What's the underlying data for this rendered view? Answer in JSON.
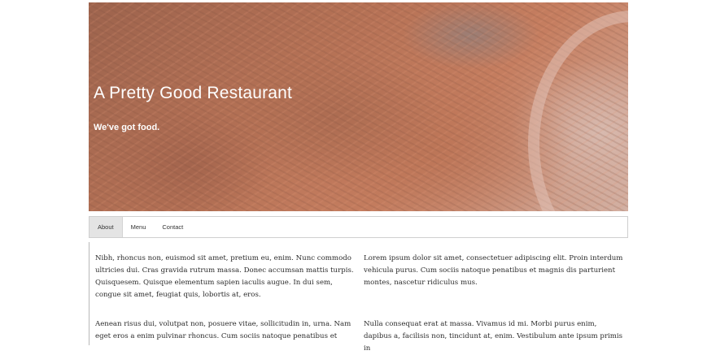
{
  "hero": {
    "title": "A Pretty Good Restaurant",
    "subtitle": "We've got food."
  },
  "tabs": [
    {
      "label": "About",
      "active": true
    },
    {
      "label": "Menu",
      "active": false
    },
    {
      "label": "Contact",
      "active": false
    }
  ],
  "content": {
    "paragraphs": [
      "Nibh, rhoncus non, euismod sit amet, pretium eu, enim. Nunc commodo ultricies dui. Cras gravida rutrum massa. Donec accumsan mattis turpis. Quisquesem. Quisque elementum sapien iaculis augue. In dui sem, congue sit amet, feugiat quis, lobortis at, eros.",
      "Lorem ipsum dolor sit amet, consectetuer adipiscing elit. Proin interdum vehicula purus. Cum sociis natoque penatibus et magnis dis parturient montes, nascetur ridiculus mus.",
      "Aenean risus dui, volutpat non, posuere vitae, sollicitudin in, urna. Nam eget eros a enim pulvinar rhoncus. Cum sociis natoque penatibus et",
      "Nulla consequat erat at massa. Vivamus id mi. Morbi purus enim, dapibus a, facilisis non, tincidunt at, enim. Vestibulum ante ipsum primis in"
    ]
  },
  "colors": {
    "hero_overlay": "#d69682",
    "tab_active_bg": "#e4e4e4",
    "text": "#2b2b2b"
  }
}
